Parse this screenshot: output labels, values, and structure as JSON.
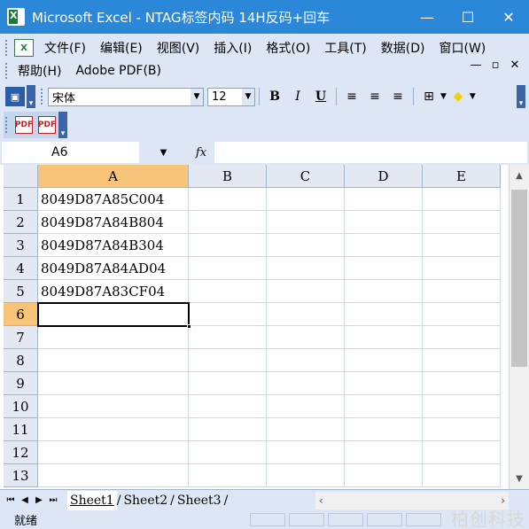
{
  "window": {
    "title": "Microsoft Excel - NTAG标签内码 14H反码+回车",
    "minimize": "—",
    "maximize": "☐",
    "close": "✕"
  },
  "menu": {
    "items": [
      "文件(F)",
      "编辑(E)",
      "视图(V)",
      "插入(I)",
      "格式(O)",
      "工具(T)",
      "数据(D)",
      "窗口(W)"
    ],
    "items_row2": [
      "帮助(H)",
      "Adobe PDF(B)"
    ],
    "mdi_controls": [
      "✕",
      "▫",
      "—"
    ]
  },
  "toolbar": {
    "font_name": "宋体",
    "font_size": "12",
    "bold": "B",
    "italic": "I",
    "underline": "U"
  },
  "pdf_toolbar": {
    "icons": [
      "adobe-pdf-icon",
      "adobe-pdf-email-icon"
    ]
  },
  "formula_bar": {
    "name_box": "A6",
    "fx_label": "fx",
    "formula": ""
  },
  "grid": {
    "columns": [
      "A",
      "B",
      "C",
      "D",
      "E"
    ],
    "active_column": "A",
    "rows": [
      "1",
      "2",
      "3",
      "4",
      "5",
      "6",
      "7",
      "8",
      "9",
      "10",
      "11",
      "12",
      "13"
    ],
    "active_row": "6",
    "cells_A": [
      "8049D87A85C004",
      "8049D87A84B804",
      "8049D87A84B304",
      "8049D87A84AD04",
      "8049D87A83CF04",
      "",
      "",
      "",
      "",
      "",
      "",
      "",
      ""
    ]
  },
  "sheets": {
    "tabs": [
      "Sheet1",
      "Sheet2",
      "Sheet3"
    ],
    "active": "Sheet1"
  },
  "status": {
    "ready": "就绪"
  },
  "watermark": "柏创科技",
  "colors": {
    "titlebar": "#2b88d8",
    "toolbar_bg": "#dce6f4",
    "header_bg": "#e3e8f3",
    "active_header": "#f8c47a"
  }
}
